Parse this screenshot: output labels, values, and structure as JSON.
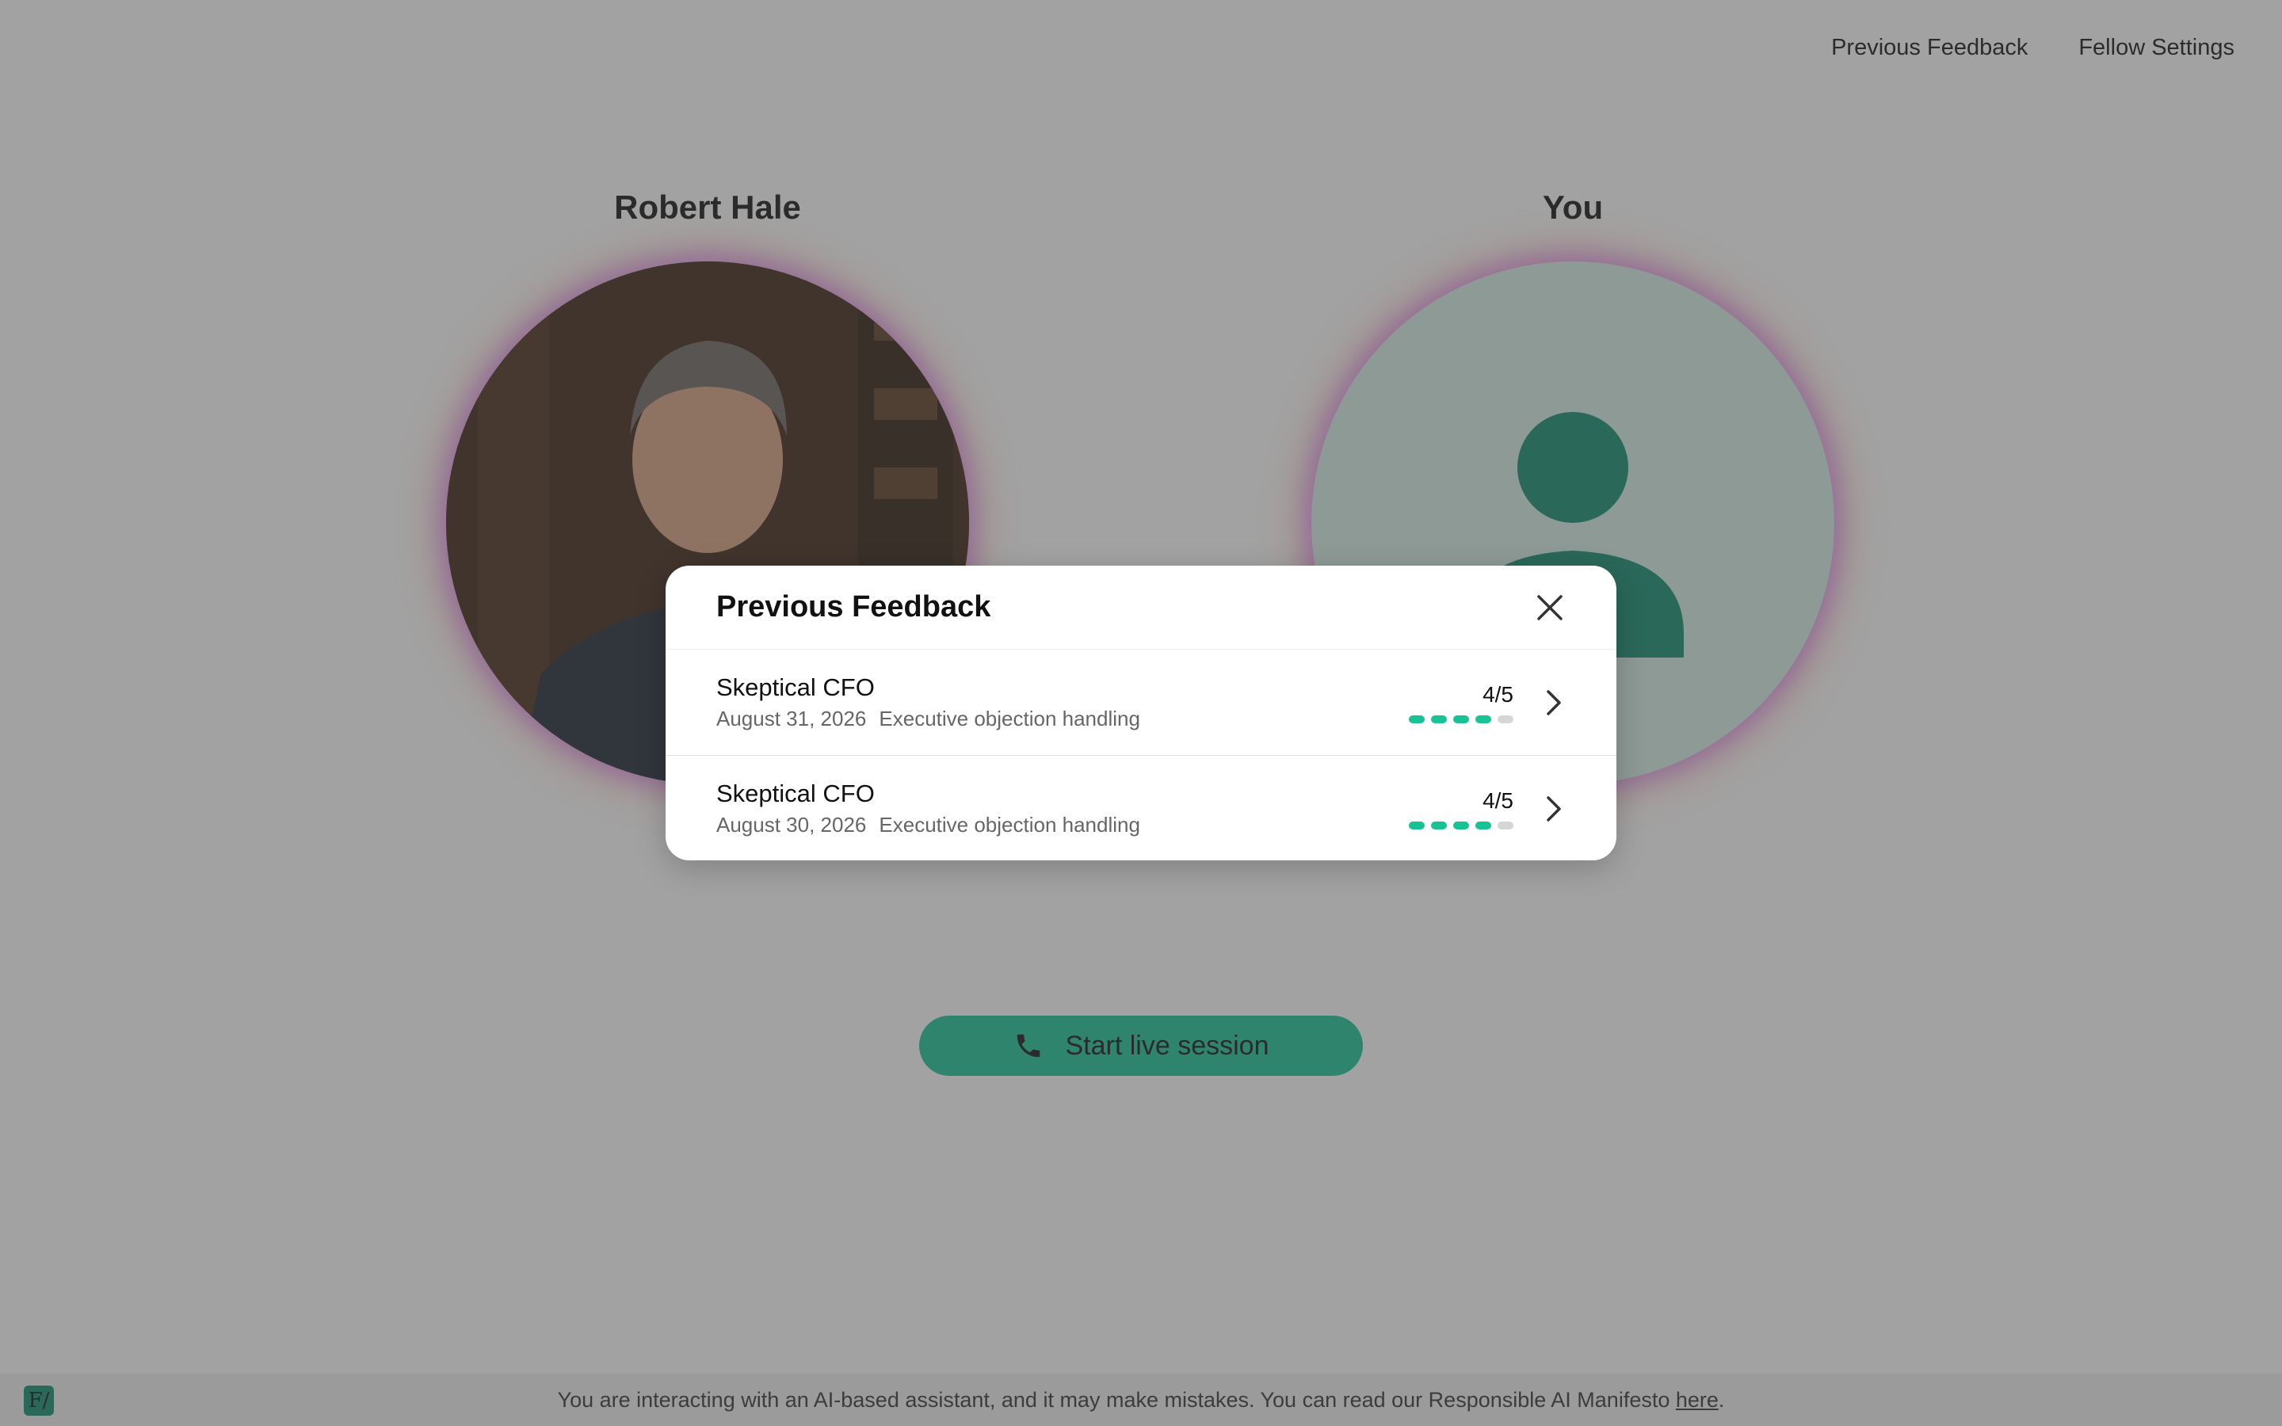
{
  "nav": {
    "previous_feedback": "Previous Feedback",
    "fellow_settings": "Fellow Settings"
  },
  "participants": {
    "left_name": "Robert Hale",
    "right_name": "You"
  },
  "start_button": {
    "label": "Start live session"
  },
  "footer": {
    "disclaimer": "You are interacting with an AI-based assistant, and it may make mistakes. You can read our Responsible AI Manifesto",
    "link": "here",
    "end": ".",
    "logo": "F/"
  },
  "modal": {
    "title": "Previous Feedback",
    "items": [
      {
        "title": "Skeptical CFO",
        "date": "August 31, 2026",
        "topic": "Executive objection handling",
        "score": "4/5",
        "rating": 4,
        "max": 5
      },
      {
        "title": "Skeptical CFO",
        "date": "August 30, 2026",
        "topic": "Executive objection handling",
        "score": "4/5",
        "rating": 4,
        "max": 5
      }
    ]
  },
  "colors": {
    "accent": "#17c394",
    "dark_accent": "#0e8b6d",
    "avatar_bg": "#d7eee6"
  }
}
